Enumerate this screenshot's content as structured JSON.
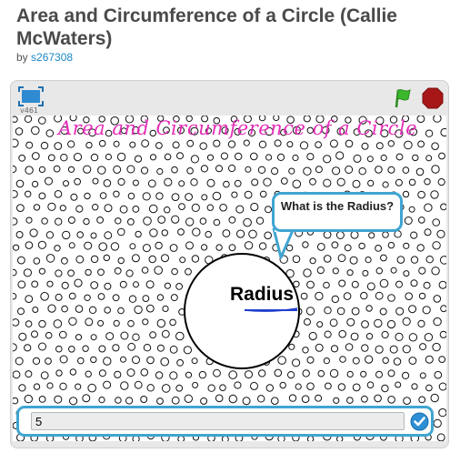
{
  "project": {
    "title": "Area and Circumference of a Circle (Callie McWaters)",
    "by_label": "by",
    "author": "s267308"
  },
  "player": {
    "version": "v461",
    "icons": {
      "fullscreen": "fullscreen-icon",
      "green_flag": "green-flag-icon",
      "stop": "stop-sign-icon",
      "submit": "checkmark-icon"
    },
    "colors": {
      "accent": "#3fa5d1",
      "heading": "#e42fb7",
      "flag": "#3cb82d",
      "stop": "#a81717"
    }
  },
  "stage": {
    "heading": "Area and Circumference of a Circle",
    "speech_bubble": "What is the Radius?",
    "radius_label": "Radius"
  },
  "ask": {
    "answer_value": "5"
  }
}
